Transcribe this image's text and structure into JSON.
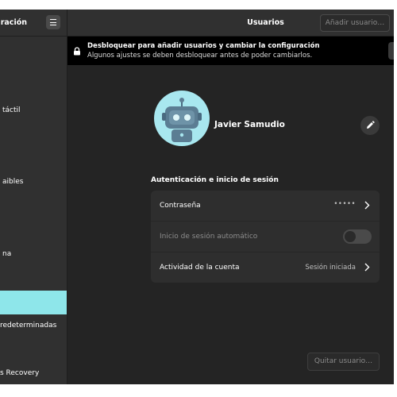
{
  "sidebar": {
    "title": "uración",
    "items": [
      {
        "label": "táctil"
      },
      {
        "label": "aibles"
      },
      {
        "label": "na"
      },
      {
        "label": ""
      },
      {
        "label": "redeterminadas"
      },
      {
        "label": "s Recovery"
      }
    ]
  },
  "header": {
    "title": "Usuarios",
    "add_user_label": "Añadir usuario…"
  },
  "unlock": {
    "title": "Desbloquear para añadir usuarios y cambiar la configuración",
    "subtitle": "Algunos ajustes se deben desbloquear antes de poder cambiarlos."
  },
  "user": {
    "name": "Javier Samudio"
  },
  "auth": {
    "section_title": "Autenticación e inicio de sesión",
    "password_label": "Contraseña",
    "password_value": "•••••",
    "autologin_label": "Inicio de sesión automático",
    "autologin_enabled": false,
    "activity_label": "Actividad de la cuenta",
    "activity_value": "Sesión iniciada"
  },
  "remove_user_label": "Quitar usuario…",
  "colors": {
    "accent": "#8ee6ea",
    "avatar_bg": "#a8e7ef"
  }
}
